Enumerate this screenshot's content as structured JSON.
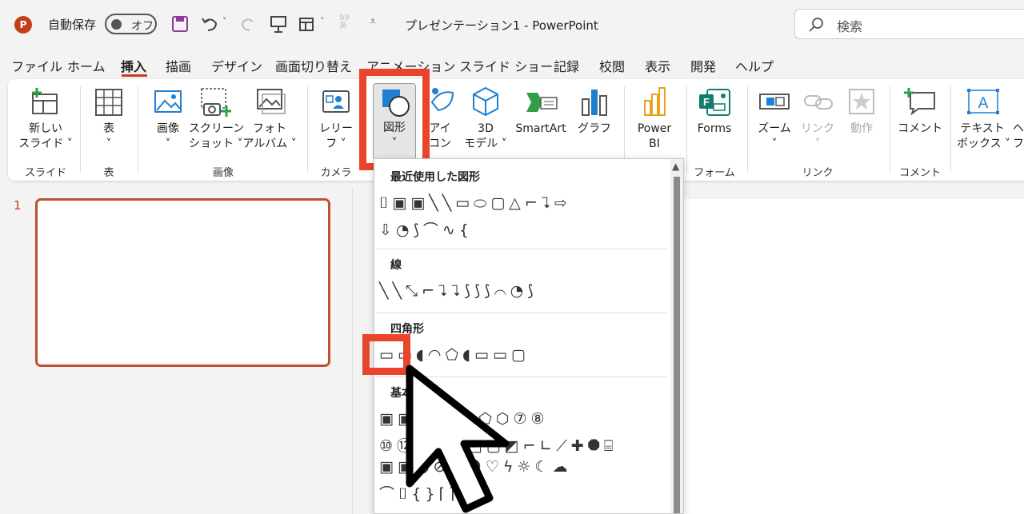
{
  "title_bar": {
    "app_badge": "P",
    "autosave_label": "自動保存",
    "autosave_state": "オフ",
    "doc_title": "プレゼンテーション1  -  PowerPoint",
    "search_placeholder": "検索"
  },
  "tabs": [
    "ファイル",
    "ホーム",
    "挿入",
    "描画",
    "デザイン",
    "画面切り替え",
    "アニメーション",
    "スライド ショー",
    "記録",
    "校閲",
    "表示",
    "開発",
    "ヘルプ"
  ],
  "active_tab": "挿入",
  "ribbon": {
    "new_slide": [
      "新しい",
      "スライド ˅"
    ],
    "table": [
      "表",
      "˅"
    ],
    "image": [
      "画像",
      "˅"
    ],
    "screenshot": [
      "スクリーン",
      "ショット ˅"
    ],
    "photo_album": [
      "フォト",
      "アルバム ˅"
    ],
    "cameo": [
      "レリー",
      "フ ˅"
    ],
    "shapes": [
      "図形",
      "˅"
    ],
    "icons": [
      "アイ",
      "コン"
    ],
    "model3d": [
      "3D",
      "モデル ˅"
    ],
    "smartart": "SmartArt",
    "graph": "グラフ",
    "powerbi": [
      "Power",
      "BI"
    ],
    "forms": "Forms",
    "zoom": [
      "ズーム",
      "˅"
    ],
    "link": [
      "リンク",
      "˅"
    ],
    "action": "動作",
    "comment": "コメント",
    "textbox": [
      "テキスト",
      "ボックス ˅"
    ],
    "more": [
      "ヘ",
      "フ"
    ],
    "groups": {
      "slide": "スライド",
      "table": "表",
      "image": "画像",
      "camera": "カメラ",
      "form": "フォーム",
      "link": "リンク",
      "comment": "コメント"
    }
  },
  "slide_panel": {
    "slide_number": "1"
  },
  "shapes_menu": {
    "sections": [
      "最近使用した図形",
      "線",
      "四角形",
      "基本"
    ],
    "recent_row1": "⌷▣▣╲╲▭⬭▢△⌐⮧⇨",
    "recent_row2": "⇩◔⟆⌒∿{",
    "lines_row": "╲╲⤡⌐⮧⮧⟆⟆⟆⌒◔⟆",
    "rect_row": "▭▭◖◠⬠◖▭▭▢",
    "basic_row1": "▣▣◬▱△◇⬠⬡⑦⑧",
    "basic_row2": "⑩⑫◔◕◑◰▢◩⌐∟⟋✚⯃⌸",
    "basic_row3": "▣▣◎⊘◿☻♡ϟ☼☾☁",
    "basic_row4": "⌒⌷{}⌈⌉{}"
  }
}
